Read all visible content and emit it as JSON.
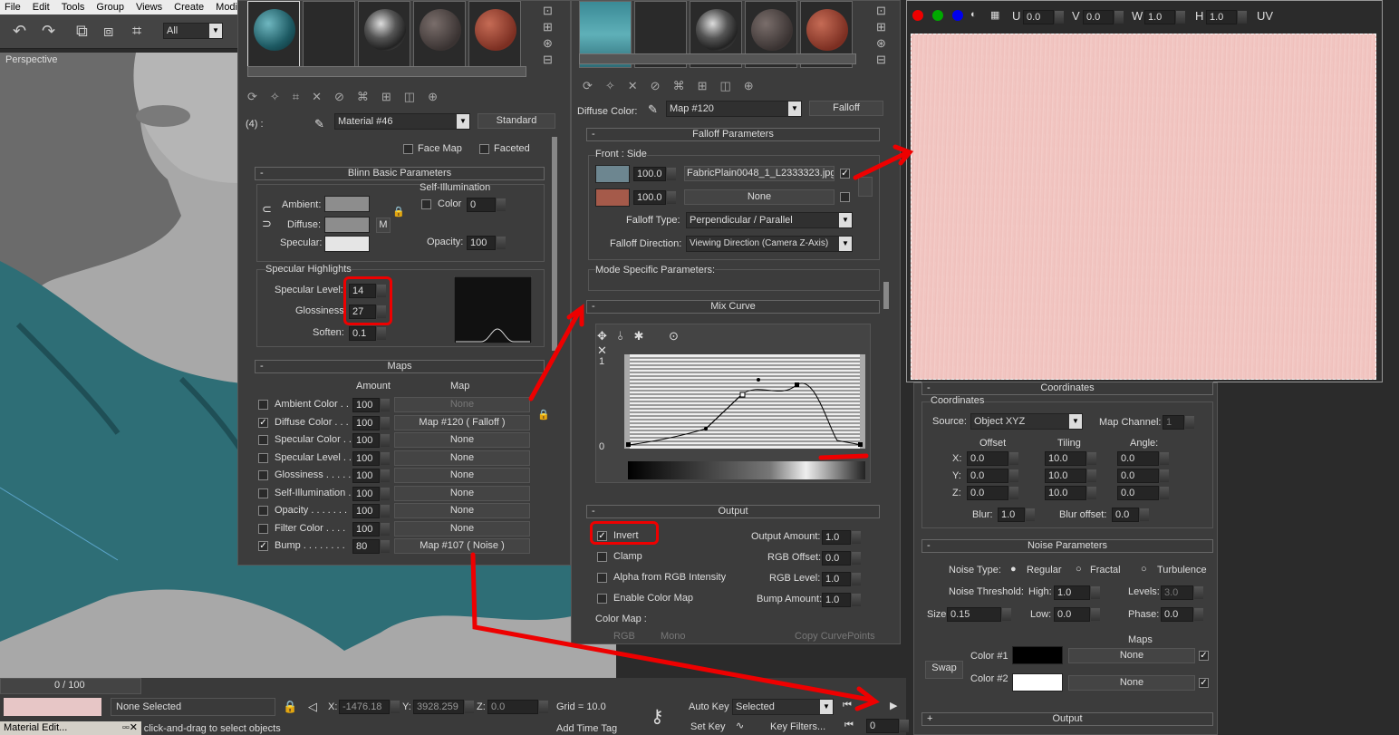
{
  "menu": [
    "File",
    "Edit",
    "Tools",
    "Group",
    "Views",
    "Create",
    "Modifier"
  ],
  "toolbar": {
    "selection_filter": "All"
  },
  "viewport": {
    "label": "Perspective"
  },
  "mat1": {
    "slot_label": "(4) :",
    "material_name": "Material #46",
    "material_type": "Standard",
    "face_map": "Face Map",
    "faceted": "Faceted",
    "blinn": "Blinn Basic Parameters",
    "self_illum": "Self-Illumination",
    "color": "Color",
    "color_val": "0",
    "ambient": "Ambient:",
    "diffuse": "Diffuse:",
    "specular": "Specular:",
    "m": "M",
    "opacity": "Opacity:",
    "opacity_val": "100",
    "spec_hl": "Specular Highlights",
    "spec_level": "Specular Level:",
    "spec_level_val": "14",
    "gloss": "Glossiness:",
    "gloss_val": "27",
    "soften": "Soften:",
    "soften_val": "0.1",
    "maps": "Maps",
    "amount": "Amount",
    "map": "Map",
    "rows": [
      {
        "name": "Ambient Color . .",
        "checked": false,
        "amt": "100",
        "map": "None"
      },
      {
        "name": "Diffuse Color . . .",
        "checked": true,
        "amt": "100",
        "map": "Map #120  ( Falloff )"
      },
      {
        "name": "Specular Color . .",
        "checked": false,
        "amt": "100",
        "map": "None"
      },
      {
        "name": "Specular Level . .",
        "checked": false,
        "amt": "100",
        "map": "None"
      },
      {
        "name": "Glossiness  . . . . .",
        "checked": false,
        "amt": "100",
        "map": "None"
      },
      {
        "name": "Self-Illumination .",
        "checked": false,
        "amt": "100",
        "map": "None"
      },
      {
        "name": "Opacity . . . . . . .",
        "checked": false,
        "amt": "100",
        "map": "None"
      },
      {
        "name": "Filter Color  . . . .",
        "checked": false,
        "amt": "100",
        "map": "None"
      },
      {
        "name": "Bump  . . . . . . . .",
        "checked": true,
        "amt": "80",
        "map": "Map #107  ( Noise )"
      }
    ]
  },
  "mat2": {
    "diffuse_color": "Diffuse Color:",
    "map_name": "Map #120",
    "map_type": "Falloff",
    "falloff_params": "Falloff Parameters",
    "front_side": "Front : Side",
    "v1": "100.0",
    "tex1": "FabricPlain0048_1_L2333323.jpg)",
    "v2": "100.0",
    "tex2": "None",
    "falloff_type": "Falloff Type:",
    "falloff_type_val": "Perpendicular / Parallel",
    "falloff_dir": "Falloff Direction:",
    "falloff_dir_val": "Viewing Direction (Camera Z-Axis)",
    "mode_specific": "Mode Specific Parameters:",
    "mix_curve": "Mix Curve",
    "y1": "1",
    "y0": "0",
    "output": "Output",
    "invert": "Invert",
    "clamp": "Clamp",
    "alpha_rgb": "Alpha from RGB Intensity",
    "enable_cmap": "Enable Color Map",
    "output_amount": "Output Amount:",
    "output_amount_val": "1.0",
    "rgb_offset": "RGB Offset:",
    "rgb_offset_val": "0.0",
    "rgb_level": "RGB Level:",
    "rgb_level_val": "1.0",
    "bump_amount": "Bump Amount:",
    "bump_amount_val": "1.0",
    "color_map": "Color Map :",
    "rgb": "RGB",
    "mono": "Mono",
    "copy_cp": "Copy CurvePoints"
  },
  "preview": {
    "u": "U",
    "u_val": "0.0",
    "v": "V",
    "v_val": "0.0",
    "w": "W",
    "w_val": "1.0",
    "h": "H",
    "h_val": "1.0",
    "uv": "UV"
  },
  "noise": {
    "coordinates_hdr": "Coordinates",
    "coordinates": "Coordinates",
    "source": "Source:",
    "source_val": "Object XYZ",
    "map_channel": "Map Channel:",
    "map_channel_val": "1",
    "offset": "Offset",
    "tiling": "Tiling",
    "angle": "Angle:",
    "x": "X:",
    "y": "Y:",
    "z": "Z:",
    "ox": "0.0",
    "oy": "0.0",
    "oz": "0.0",
    "tx": "10.0",
    "ty": "10.0",
    "tz": "10.0",
    "ax": "0.0",
    "ay": "0.0",
    "az": "0.0",
    "blur": "Blur:",
    "blur_val": "1.0",
    "blur_offset": "Blur offset:",
    "blur_offset_val": "0.0",
    "noise_params": "Noise Parameters",
    "noise_type": "Noise Type:",
    "regular": "Regular",
    "fractal": "Fractal",
    "turbulence": "Turbulence",
    "threshold": "Noise Threshold:",
    "high": "High:",
    "high_val": "1.0",
    "levels": "Levels:",
    "levels_val": "3.0",
    "size": "Size:",
    "size_val": "0.15",
    "low": "Low:",
    "low_val": "0.0",
    "phase": "Phase:",
    "phase_val": "0.0",
    "maps": "Maps",
    "color1": "Color #1",
    "color2": "Color #2",
    "none": "None",
    "swap": "Swap",
    "output": "Output",
    "plus": "+"
  },
  "status": {
    "frame": "0 / 100",
    "none_selected": "None Selected",
    "x": "X:",
    "x_val": "-1476.18",
    "y": "Y:",
    "y_val": "3928.259",
    "z": "Z:",
    "z_val": "0.0",
    "grid": "Grid = 10.0",
    "auto_key": "Auto Key",
    "selected": "Selected",
    "set_key": "Set Key",
    "key_filters": "Key Filters...",
    "add_time_tag": "Add Time Tag",
    "hint": "r click-and-drag to select objects",
    "frame_num": "0",
    "taskbar": "Material Edit..."
  }
}
